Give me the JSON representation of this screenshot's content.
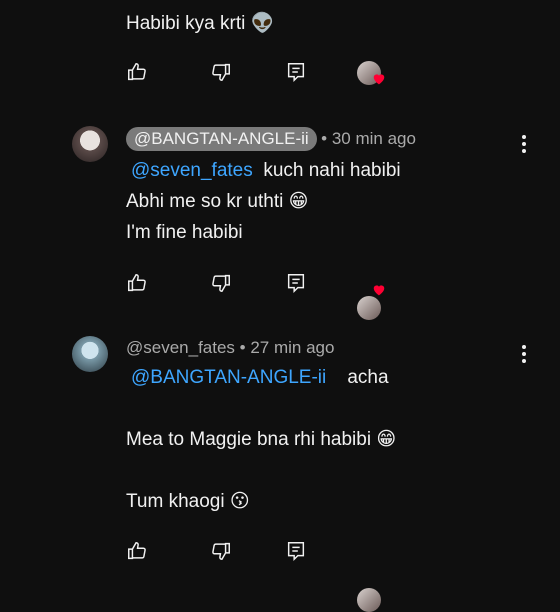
{
  "comments": [
    {
      "text_lines": [
        "Habibi kya krti 👽"
      ]
    },
    {
      "author": "@BANGTAN-ANGLE-ii",
      "time": "• 30 min ago",
      "mention": "@seven_fates",
      "mention_rest": "kuch nahi habibi",
      "line2": "Abhi me so kr uthti 😁",
      "line3": "I'm fine habibi"
    },
    {
      "author": "@seven_fates • 27 min ago",
      "mention": "@BANGTAN-ANGLE-ii",
      "mention_rest": "acha",
      "line2": "Mea to Maggie bna rhi habibi 😁",
      "line3": "Tum khaogi 😗"
    }
  ],
  "icons": {
    "like": "thumbs-up-icon",
    "dislike": "thumbs-down-icon",
    "reply": "reply-icon",
    "more": "more-vert-icon",
    "heart": "heart-icon"
  },
  "colors": {
    "background": "#0f0f0f",
    "mention": "#3ea6ff",
    "heart": "#ff0033"
  }
}
